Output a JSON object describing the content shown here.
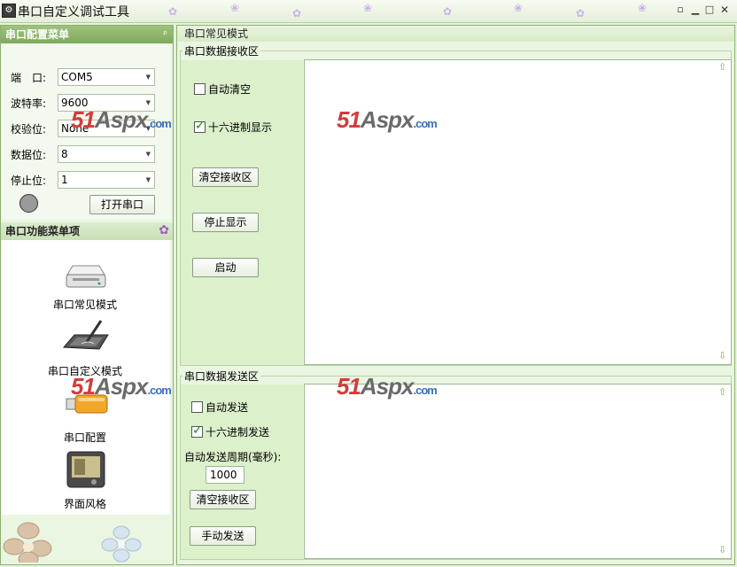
{
  "window": {
    "title": "串口自定义调试工具",
    "app_icon": "app-icon"
  },
  "config_panel": {
    "title": "串口配置菜单",
    "pin": "ᵖ",
    "fields": [
      {
        "label": "端　口:",
        "value": "COM5"
      },
      {
        "label": "波特率:",
        "value": "9600"
      },
      {
        "label": "校验位:",
        "value": "None"
      },
      {
        "label": "数据位:",
        "value": "8"
      },
      {
        "label": "停止位:",
        "value": "1"
      }
    ],
    "open_button": "打开串口",
    "led_color": "#9a9a9a"
  },
  "function_panel": {
    "title": "串口功能菜单项",
    "items": [
      {
        "label": "串口常见模式",
        "icon": "printer-icon"
      },
      {
        "label": "串口自定义模式",
        "icon": "pen-tablet-icon"
      },
      {
        "label": "串口配置",
        "icon": "usb-drive-icon"
      },
      {
        "label": "界面风格",
        "icon": "media-player-icon"
      }
    ]
  },
  "main": {
    "title": "串口常见模式",
    "receive": {
      "title": "串口数据接收区",
      "auto_clear": {
        "label": "自动清空",
        "checked": false
      },
      "hex_display": {
        "label": "十六进制显示",
        "checked": true
      },
      "clear_button": "清空接收区",
      "stop_button": "停止显示",
      "start_button": "启动"
    },
    "send": {
      "title": "串口数据发送区",
      "auto_send": {
        "label": "自动发送",
        "checked": false
      },
      "hex_send": {
        "label": "十六进制发送",
        "checked": true
      },
      "period_label": "自动发送周期(毫秒):",
      "period_value": "1000",
      "clear_button": "清空接收区",
      "manual_button": "手动发送"
    }
  },
  "watermark": {
    "num": "51",
    "mid": "Aspx",
    "suffix": ".com"
  },
  "colors": {
    "header": "#8db46b",
    "panel_bg": "#eaf6e1",
    "control_bg": "#dbf0cb",
    "watermark": "#d23c3c"
  }
}
